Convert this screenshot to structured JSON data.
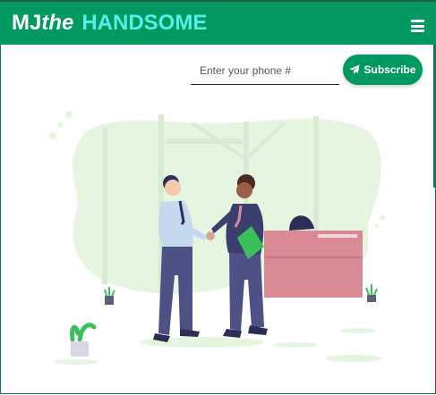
{
  "navbar": {
    "brand_part1": "MJ",
    "brand_part2": "the",
    "brand_part3": "HANDSOME",
    "menu_icon": "hamburger-menu-icon",
    "background_color": "#009960",
    "accent_color": "#52f0e8"
  },
  "subscribe": {
    "phone_placeholder": "Enter your phone #",
    "phone_value": "",
    "button_label": "Subscribe",
    "button_icon": "paper-plane-icon"
  },
  "hero": {
    "illustration": "business-handshake-illustration"
  }
}
